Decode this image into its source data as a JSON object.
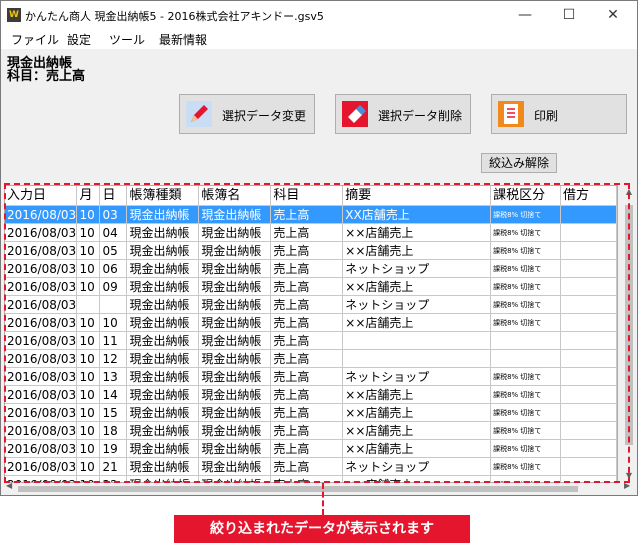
{
  "window": {
    "title": "かんたん商人 現金出納帳5 - 2016株式会社アキンドー.gsv5",
    "minimize": "—",
    "maximize": "☐",
    "close": "✕"
  },
  "menu": [
    "ファイル",
    "設定",
    "ツール",
    "最新情報"
  ],
  "header": {
    "book": "現金出納帳",
    "account": "科目：売上高"
  },
  "toolbar": {
    "edit_label": "選択データ変更",
    "delete_label": "選択データ削除",
    "print_label": "印刷",
    "filter_clear_label": "絞込み解除"
  },
  "table": {
    "columns": [
      "入力日",
      "月",
      "日",
      "帳簿種類",
      "帳簿名",
      "科目",
      "摘要",
      "課税区分",
      "借方"
    ],
    "rows": [
      [
        "2016/08/03",
        "10",
        "03",
        "現金出納帳",
        "現金出納帳",
        "売上高",
        "XX店舗売上",
        "課税8% 切捨て",
        ""
      ],
      [
        "2016/08/03",
        "10",
        "04",
        "現金出納帳",
        "現金出納帳",
        "売上高",
        "××店舗売上",
        "課税8% 切捨て",
        ""
      ],
      [
        "2016/08/03",
        "10",
        "05",
        "現金出納帳",
        "現金出納帳",
        "売上高",
        "××店舗売上",
        "課税8% 切捨て",
        ""
      ],
      [
        "2016/08/03",
        "10",
        "06",
        "現金出納帳",
        "現金出納帳",
        "売上高",
        "ネットショップ",
        "課税8% 切捨て",
        ""
      ],
      [
        "2016/08/03",
        "10",
        "09",
        "現金出納帳",
        "現金出納帳",
        "売上高",
        "××店舗売上",
        "課税8% 切捨て",
        ""
      ],
      [
        "2016/08/03",
        "",
        "",
        "現金出納帳",
        "現金出納帳",
        "売上高",
        "ネットショップ",
        "課税8% 切捨て",
        ""
      ],
      [
        "2016/08/03",
        "10",
        "10",
        "現金出納帳",
        "現金出納帳",
        "売上高",
        "××店舗売上",
        "課税8% 切捨て",
        ""
      ],
      [
        "2016/08/03",
        "10",
        "11",
        "現金出納帳",
        "現金出納帳",
        "売上高",
        "",
        "",
        ""
      ],
      [
        "2016/08/03",
        "10",
        "12",
        "現金出納帳",
        "現金出納帳",
        "売上高",
        "",
        "",
        ""
      ],
      [
        "2016/08/03",
        "10",
        "13",
        "現金出納帳",
        "現金出納帳",
        "売上高",
        "ネットショップ",
        "課税8% 切捨て",
        ""
      ],
      [
        "2016/08/03",
        "10",
        "14",
        "現金出納帳",
        "現金出納帳",
        "売上高",
        "××店舗売上",
        "課税8% 切捨て",
        ""
      ],
      [
        "2016/08/03",
        "10",
        "15",
        "現金出納帳",
        "現金出納帳",
        "売上高",
        "××店舗売上",
        "課税8% 切捨て",
        ""
      ],
      [
        "2016/08/03",
        "10",
        "18",
        "現金出納帳",
        "現金出納帳",
        "売上高",
        "××店舗売上",
        "課税8% 切捨て",
        ""
      ],
      [
        "2016/08/03",
        "10",
        "19",
        "現金出納帳",
        "現金出納帳",
        "売上高",
        "××店舗売上",
        "課税8% 切捨て",
        ""
      ],
      [
        "2016/08/03",
        "10",
        "21",
        "現金出納帳",
        "現金出納帳",
        "売上高",
        "ネットショップ",
        "課税8% 切捨て",
        ""
      ],
      [
        "2016/08/03",
        "10",
        "22",
        "現金出納帳",
        "現金出納帳",
        "売上高",
        "××店舗売上",
        "課税8% 切捨て",
        ""
      ]
    ],
    "selected_row": 0
  },
  "callout": "絞り込まれたデータが表示されます",
  "colors": {
    "accent": "#e5152d",
    "selection": "#3399ff"
  },
  "icons": [
    "app-icon",
    "pencil-icon",
    "eraser-icon",
    "print-icon"
  ]
}
